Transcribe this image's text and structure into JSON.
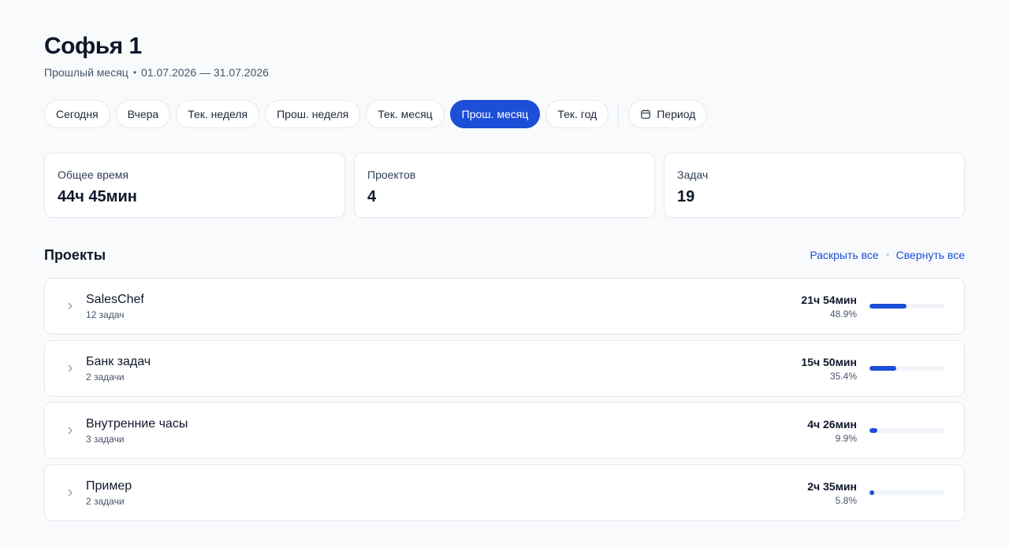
{
  "header": {
    "title": "Софья 1",
    "period_label": "Прошлый месяц",
    "period_range": "01.07.2026 — 31.07.2026"
  },
  "filters": [
    {
      "label": "Сегодня",
      "active": false
    },
    {
      "label": "Вчера",
      "active": false
    },
    {
      "label": "Тек. неделя",
      "active": false
    },
    {
      "label": "Прош. неделя",
      "active": false
    },
    {
      "label": "Тек. месяц",
      "active": false
    },
    {
      "label": "Прош. месяц",
      "active": true
    },
    {
      "label": "Тек. год",
      "active": false
    }
  ],
  "period_button": {
    "label": "Период",
    "icon": "calendar-icon"
  },
  "stats": {
    "total_time": {
      "label": "Общее время",
      "value": "44ч 45мин"
    },
    "projects": {
      "label": "Проектов",
      "value": "4"
    },
    "tasks": {
      "label": "Задач",
      "value": "19"
    }
  },
  "projects_section": {
    "title": "Проекты",
    "expand_all": "Раскрыть все",
    "collapse_all": "Свернуть все"
  },
  "projects": [
    {
      "name": "SalesChef",
      "tasks": "12 задач",
      "time": "21ч 54мин",
      "percent_label": "48.9%",
      "percent": 48.9
    },
    {
      "name": "Банк задач",
      "tasks": "2 задачи",
      "time": "15ч 50мин",
      "percent_label": "35.4%",
      "percent": 35.4
    },
    {
      "name": "Внутренние часы",
      "tasks": "3 задачи",
      "time": "4ч 26мин",
      "percent_label": "9.9%",
      "percent": 9.9
    },
    {
      "name": "Пример",
      "tasks": "2 задачи",
      "time": "2ч 35мин",
      "percent_label": "5.8%",
      "percent": 5.8
    }
  ],
  "colors": {
    "accent": "#1d4ed8",
    "background": "#f8fafc",
    "border": "#e2e8f0",
    "bar_track": "#f1f5f9"
  }
}
